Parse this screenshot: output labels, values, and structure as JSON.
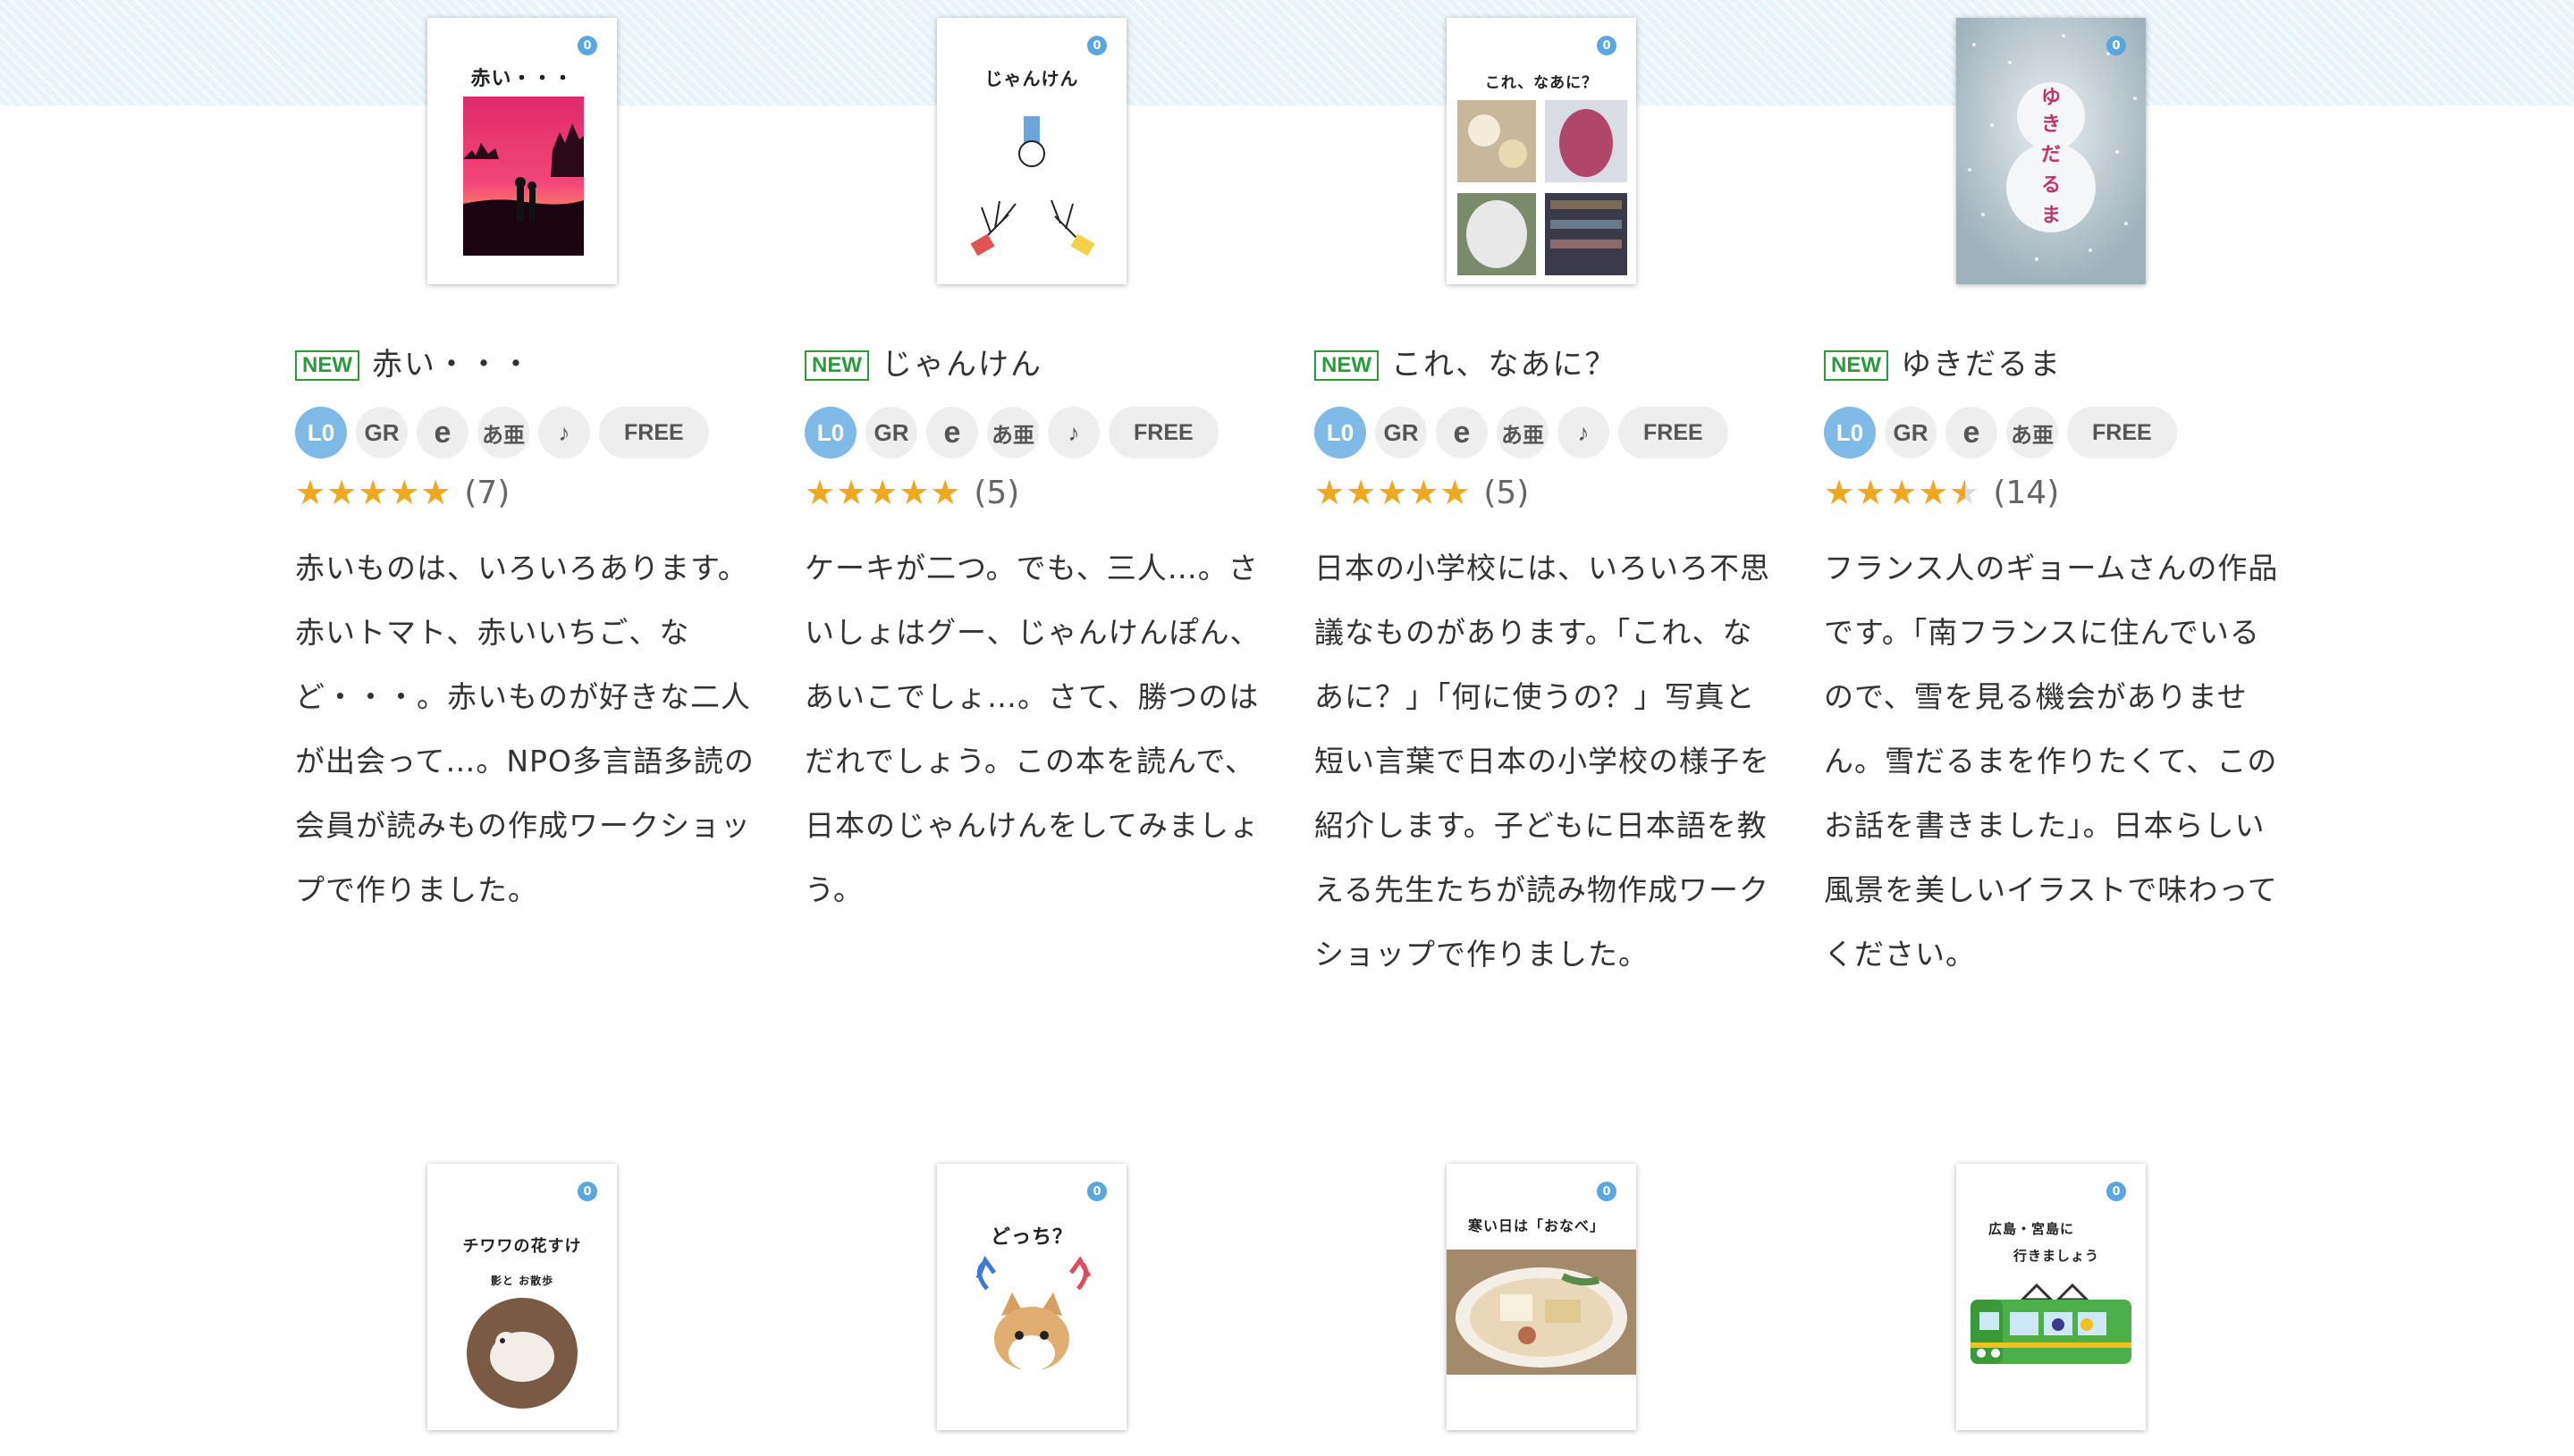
{
  "colors": {
    "accent_blue": "#5aa6e0",
    "new_green": "#2a9a3c",
    "star_gold": "#f0a81e"
  },
  "books": [
    {
      "cover_level": "0",
      "cover_title": "赤い・・・",
      "new_label": "NEW",
      "title": "赤い・・・",
      "tags": [
        "L0",
        "GR",
        "e",
        "あ亜",
        "♪",
        "FREE"
      ],
      "rating": 5,
      "rating_count": "(7)",
      "description": "赤いものは、いろいろあります。赤いトマト、赤いいちご、など・・・。赤いものが好きな二人が出会って…。NPO多言語多読の会員が読みもの作成ワークショップで作りました。"
    },
    {
      "cover_level": "0",
      "cover_title": "じゃんけん",
      "new_label": "NEW",
      "title": "じゃんけん",
      "tags": [
        "L0",
        "GR",
        "e",
        "あ亜",
        "♪",
        "FREE"
      ],
      "rating": 5,
      "rating_count": "(5)",
      "description": "ケーキが二つ。でも、三人…。さいしょはグー、じゃんけんぽん、あいこでしょ…。さて、勝つのはだれでしょう。この本を読んで、日本のじゃんけんをしてみましょう。"
    },
    {
      "cover_level": "0",
      "cover_title": "これ、なあに？",
      "new_label": "NEW",
      "title": "これ、なあに？",
      "tags": [
        "L0",
        "GR",
        "e",
        "あ亜",
        "♪",
        "FREE"
      ],
      "rating": 5,
      "rating_count": "(5)",
      "description": "日本の小学校には、いろいろ不思議なものがあります。「これ、なあに？」「何に使うの？」写真と短い言葉で日本の小学校の様子を紹介します。子どもに日本語を教える先生たちが読み物作成ワークショップで作りました。"
    },
    {
      "cover_level": "0",
      "cover_title": "ゆきだるま",
      "new_label": "NEW",
      "title": "ゆきだるま",
      "tags": [
        "L0",
        "GR",
        "e",
        "あ亜",
        "FREE"
      ],
      "rating": 4.5,
      "rating_count": "(14)",
      "description": "フランス人のギョームさんの作品です。「南フランスに住んでいるので、雪を見る機会がありません。雪だるまを作りたくて、このお話を書きました」。日本らしい風景を美しいイラストで味わってください。"
    },
    {
      "cover_level": "0",
      "cover_title": "チワワの花すけ",
      "cover_subtitle": "影と お散歩"
    },
    {
      "cover_level": "0",
      "cover_title": "どっち？"
    },
    {
      "cover_level": "0",
      "cover_title": "寒い日は「おなべ」"
    },
    {
      "cover_level": "0",
      "cover_title": "広島・宮島に",
      "cover_subtitle": "行きましょう"
    }
  ]
}
